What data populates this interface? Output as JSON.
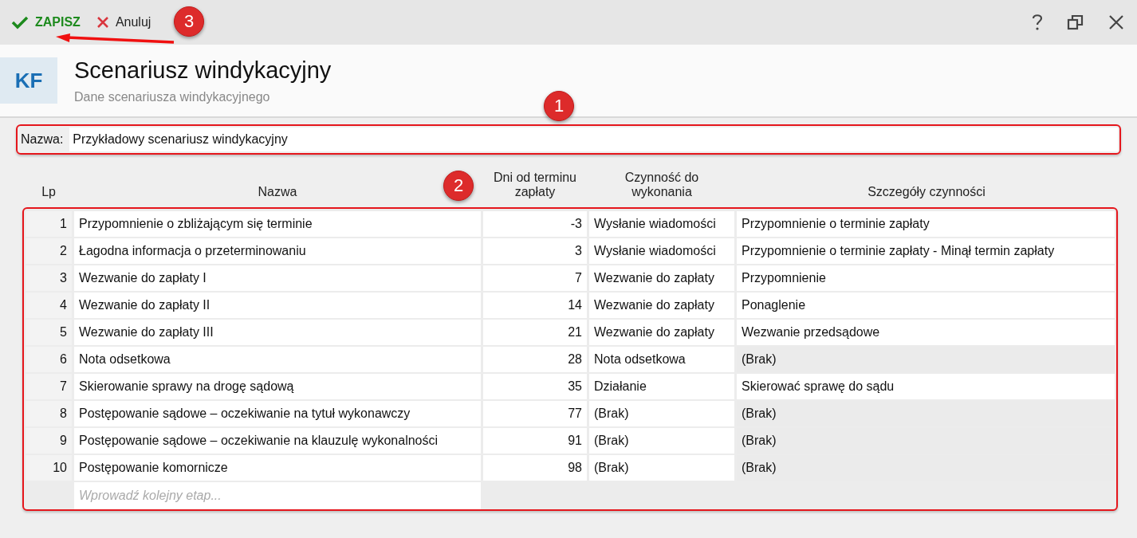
{
  "toolbar": {
    "save": "ZAPISZ",
    "cancel": "Anuluj"
  },
  "header": {
    "avatar": "KF",
    "title": "Scenariusz windykacyjny",
    "subtitle": "Dane scenariusza windykacyjnego"
  },
  "name_field": {
    "label": "Nazwa:",
    "value": "Przykładowy scenariusz windykacyjny"
  },
  "table": {
    "columns": [
      "Lp",
      "Nazwa",
      "Dni od terminu zapłaty",
      "Czynność do wykonania",
      "Szczegóły czynności"
    ],
    "rows": [
      {
        "lp": "1",
        "name": "Przypomnienie o zbliżającym się terminie",
        "days": "-3",
        "action": "Wysłanie wiadomości",
        "details": "Przypomnienie o terminie zapłaty",
        "details_readonly": false
      },
      {
        "lp": "2",
        "name": "Łagodna informacja o przeterminowaniu",
        "days": "3",
        "action": "Wysłanie wiadomości",
        "details": "Przypomnienie o terminie zapłaty - Minął termin zapłaty",
        "details_readonly": false
      },
      {
        "lp": "3",
        "name": "Wezwanie do zapłaty I",
        "days": "7",
        "action": "Wezwanie do zapłaty",
        "details": "Przypomnienie",
        "details_readonly": false
      },
      {
        "lp": "4",
        "name": "Wezwanie do zapłaty II",
        "days": "14",
        "action": "Wezwanie do zapłaty",
        "details": "Ponaglenie",
        "details_readonly": false
      },
      {
        "lp": "5",
        "name": "Wezwanie do zapłaty III",
        "days": "21",
        "action": "Wezwanie do zapłaty",
        "details": "Wezwanie przedsądowe",
        "details_readonly": false
      },
      {
        "lp": "6",
        "name": "Nota odsetkowa",
        "days": "28",
        "action": "Nota odsetkowa",
        "details": "(Brak)",
        "details_readonly": true
      },
      {
        "lp": "7",
        "name": "Skierowanie sprawy na drogę sądową",
        "days": "35",
        "action": "Działanie",
        "details": "Skierować sprawę do sądu",
        "details_readonly": false
      },
      {
        "lp": "8",
        "name": "Postępowanie sądowe – oczekiwanie na tytuł wykonawczy",
        "days": "77",
        "action": "(Brak)",
        "details": "(Brak)",
        "details_readonly": true
      },
      {
        "lp": "9",
        "name": "Postępowanie sądowe – oczekiwanie na klauzulę wykonalności",
        "days": "91",
        "action": "(Brak)",
        "details": "(Brak)",
        "details_readonly": true
      },
      {
        "lp": "10",
        "name": "Postępowanie komornicze",
        "days": "98",
        "action": "(Brak)",
        "details": "(Brak)",
        "details_readonly": true
      }
    ],
    "new_row_placeholder": "Wprowadź kolejny etap..."
  },
  "annotations": [
    {
      "label": "1"
    },
    {
      "label": "2"
    },
    {
      "label": "3"
    }
  ]
}
